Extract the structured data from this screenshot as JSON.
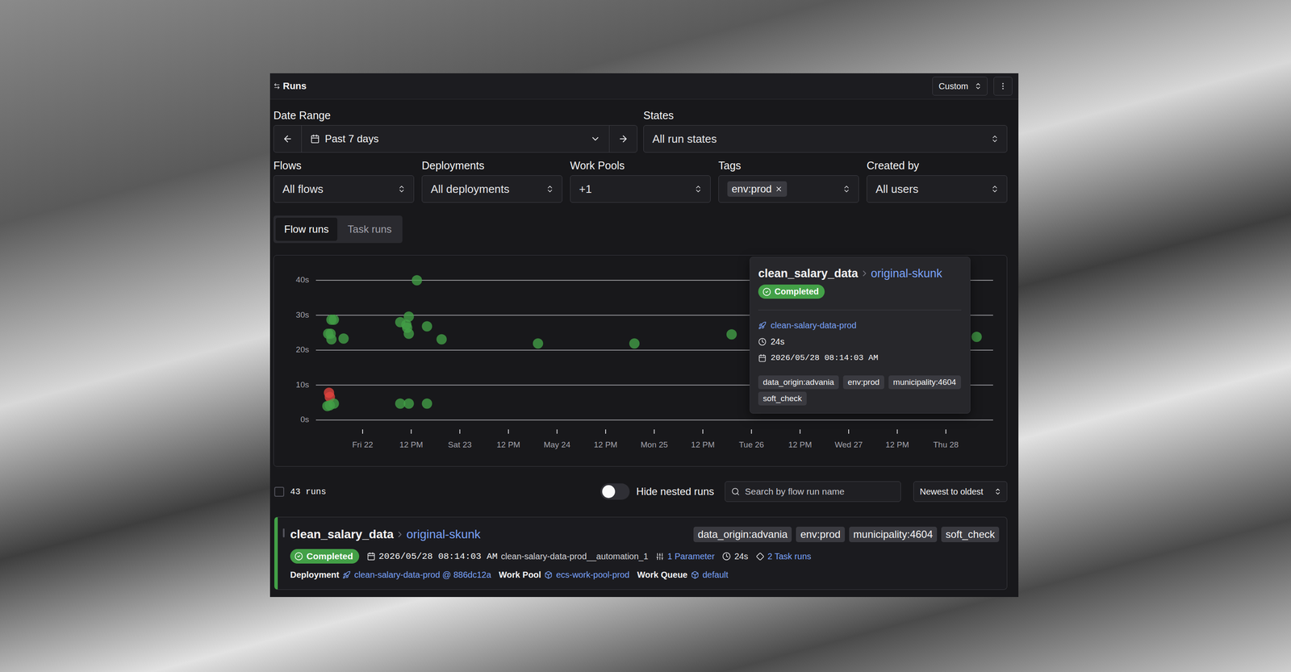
{
  "header": {
    "title": "Runs",
    "view_select": "Custom"
  },
  "filters": {
    "date_range": {
      "label": "Date Range",
      "value": "Past 7 days"
    },
    "states": {
      "label": "States",
      "value": "All run states"
    },
    "flows": {
      "label": "Flows",
      "value": "All flows"
    },
    "deployments": {
      "label": "Deployments",
      "value": "All deployments"
    },
    "work_pools": {
      "label": "Work Pools",
      "value": "+1"
    },
    "tags": {
      "label": "Tags",
      "chips": [
        "env:prod"
      ]
    },
    "created_by": {
      "label": "Created by",
      "value": "All users"
    }
  },
  "tabs": [
    {
      "label": "Flow runs",
      "selected": true
    },
    {
      "label": "Task runs",
      "selected": false
    }
  ],
  "chart": {
    "y_ticks": [
      {
        "label": "40s",
        "value": 40
      },
      {
        "label": "30s",
        "value": 30
      },
      {
        "label": "20s",
        "value": 20
      },
      {
        "label": "10s",
        "value": 10
      },
      {
        "label": "0s",
        "value": 0
      }
    ],
    "x_ticks": [
      "Fri 22",
      "12 PM",
      "Sat 23",
      "12 PM",
      "May 24",
      "12 PM",
      "Mon 25",
      "12 PM",
      "Tue 26",
      "12 PM",
      "Wed 27",
      "12 PM",
      "Thu 28"
    ],
    "points": [
      {
        "hours": -7.7,
        "seconds": 28.7,
        "color": "#43a047"
      },
      {
        "hours": -7.1,
        "seconds": 28.7,
        "color": "#43a047"
      },
      {
        "hours": -8.5,
        "seconds": 24.7,
        "color": "#43a047"
      },
      {
        "hours": -7.9,
        "seconds": 24.7,
        "color": "#43a047"
      },
      {
        "hours": -7.7,
        "seconds": 23.1,
        "color": "#43a047"
      },
      {
        "hours": -4.7,
        "seconds": 23.3,
        "color": "#43a047"
      },
      {
        "hours": -8.3,
        "seconds": 7.8,
        "color": "#e0443e"
      },
      {
        "hours": -8.1,
        "seconds": 6.6,
        "color": "#e0443e"
      },
      {
        "hours": -8.7,
        "seconds": 4.0,
        "color": "#43a047"
      },
      {
        "hours": -7.1,
        "seconds": 4.7,
        "color": "#43a047"
      },
      {
        "hours": -8.1,
        "seconds": 4.2,
        "color": "#43a047"
      },
      {
        "hours": 9.3,
        "seconds": 28.0,
        "color": "#43a047"
      },
      {
        "hours": 11.4,
        "seconds": 29.6,
        "color": "#43a047"
      },
      {
        "hours": 11.0,
        "seconds": 26.4,
        "color": "#43a047"
      },
      {
        "hours": 10.8,
        "seconds": 27.3,
        "color": "#43a047"
      },
      {
        "hours": 11.4,
        "seconds": 24.7,
        "color": "#43a047"
      },
      {
        "hours": 15.9,
        "seconds": 26.8,
        "color": "#43a047"
      },
      {
        "hours": 19.5,
        "seconds": 23.1,
        "color": "#43a047"
      },
      {
        "hours": 13.4,
        "seconds": 40.0,
        "color": "#43a047"
      },
      {
        "hours": 9.3,
        "seconds": 4.7,
        "color": "#43a047"
      },
      {
        "hours": 11.4,
        "seconds": 4.7,
        "color": "#43a047"
      },
      {
        "hours": 15.9,
        "seconds": 4.7,
        "color": "#43a047"
      },
      {
        "hours": 43.3,
        "seconds": 21.9,
        "color": "#43a047"
      },
      {
        "hours": 67.1,
        "seconds": 21.9,
        "color": "#43a047"
      },
      {
        "hours": 91.1,
        "seconds": 24.5,
        "color": "#43a047"
      },
      {
        "hours": 151.6,
        "seconds": 23.8,
        "color": "#43a047"
      }
    ]
  },
  "tooltip": {
    "flow": "clean_salary_data",
    "name": "original-skunk",
    "state": "Completed",
    "deployment": "clean-salary-data-prod",
    "duration": "24s",
    "start": "2026/05/28 08:14:03 AM",
    "tags": [
      "data_origin:advania",
      "env:prod",
      "municipality:4604",
      "soft_check"
    ]
  },
  "list_bar": {
    "select_all_checked": false,
    "count": "43 runs",
    "hide_nested": {
      "label": "Hide nested runs",
      "on": false
    },
    "search": {
      "placeholder": "Search by flow run name"
    },
    "sort": "Newest to oldest"
  },
  "runs": [
    {
      "checked": false,
      "flow": "clean_salary_data",
      "name": "original-skunk",
      "state": "Completed",
      "color": "#43a047",
      "tags": [
        "data_origin:advania",
        "env:prod",
        "municipality:4604",
        "soft_check"
      ],
      "start": "2026/05/28 08:14:03 AM",
      "created_by": "clean-salary-data-prod__automation_1",
      "parameters": "1 Parameter",
      "duration": "24s",
      "task_runs": "2 Task runs",
      "deployment_label": "Deployment",
      "deployment": "clean-salary-data-prod @ 886dc12a",
      "work_pool_label": "Work Pool",
      "work_pool": "ecs-work-pool-prod",
      "work_queue_label": "Work Queue",
      "work_queue": "default"
    }
  ]
}
